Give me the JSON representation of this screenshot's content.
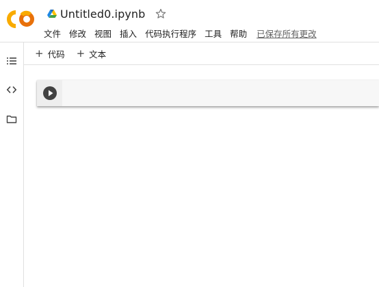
{
  "header": {
    "document_title": "Untitled0.ipynb",
    "menu": [
      {
        "label": "文件"
      },
      {
        "label": "修改"
      },
      {
        "label": "视图"
      },
      {
        "label": "插入"
      },
      {
        "label": "代码执行程序"
      },
      {
        "label": "工具"
      },
      {
        "label": "帮助"
      }
    ],
    "save_status": "已保存所有更改"
  },
  "toolbar": {
    "add_code_label": "代码",
    "add_text_label": "文本"
  },
  "sidebar": {
    "items": [
      {
        "icon": "table-of-contents-icon"
      },
      {
        "icon": "code-snippets-icon"
      },
      {
        "icon": "folder-icon"
      }
    ]
  },
  "cell": {
    "type": "code",
    "content": ""
  },
  "colors": {
    "logo_orange": "#F9AB00",
    "logo_dark_orange": "#E8710A",
    "run_button": "#424242",
    "cell_background": "#F7F7F7"
  }
}
